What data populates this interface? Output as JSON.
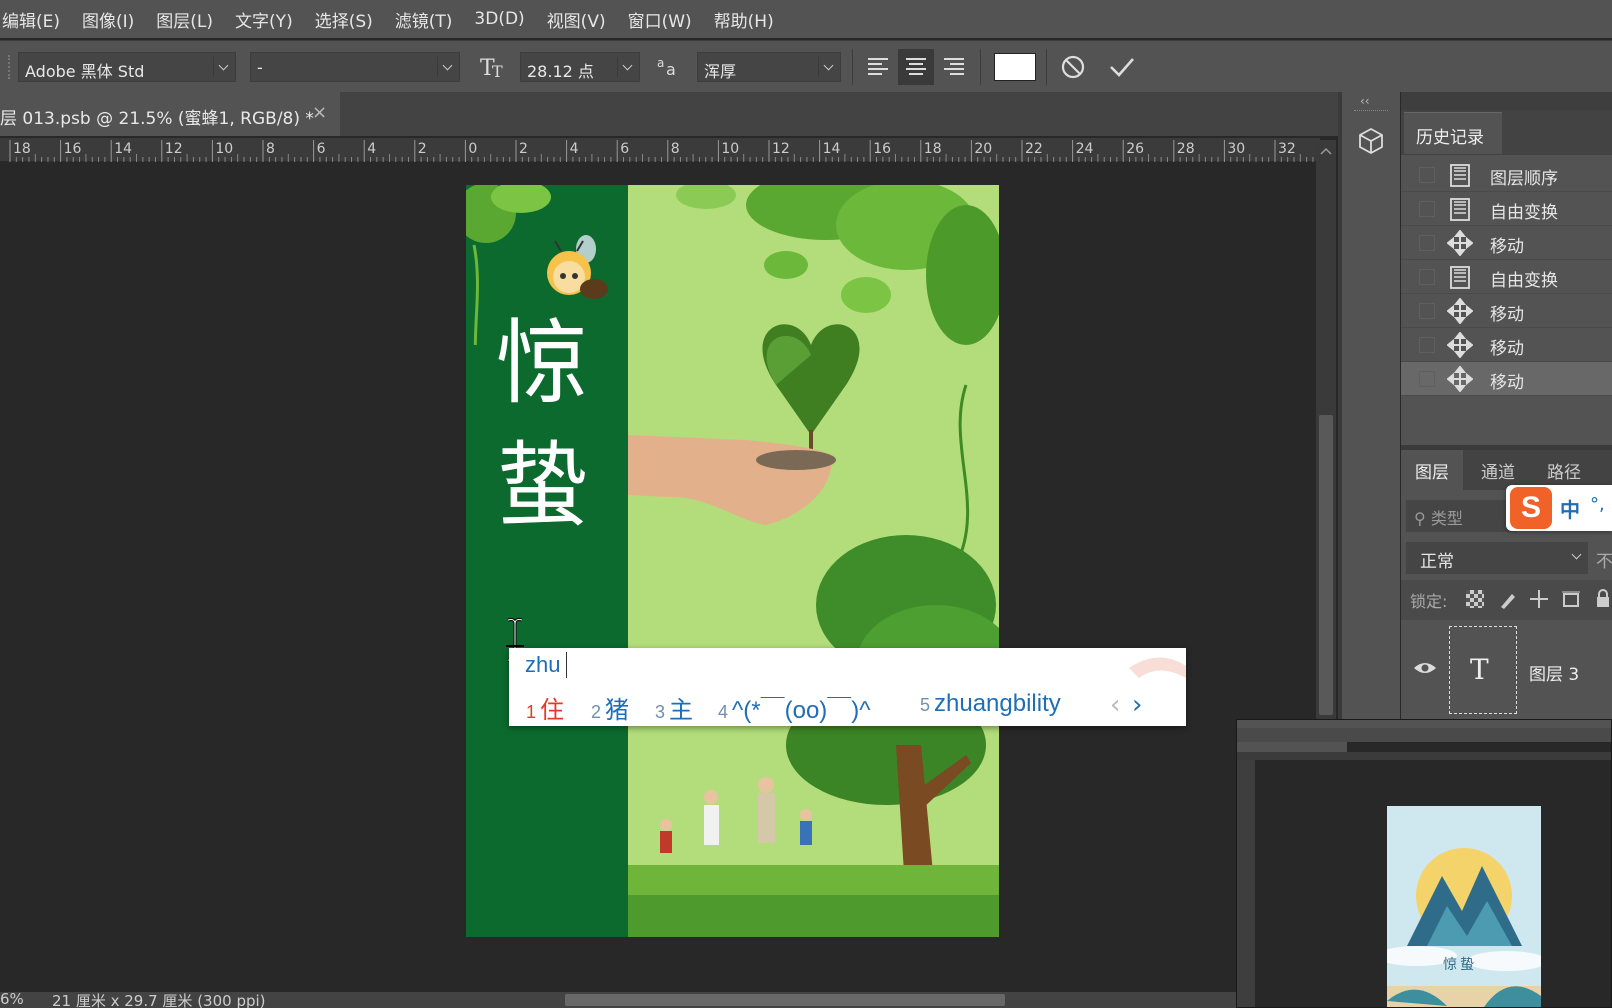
{
  "menu": [
    "编辑(E)",
    "图像(I)",
    "图层(L)",
    "文字(Y)",
    "选择(S)",
    "滤镜(T)",
    "3D(D)",
    "视图(V)",
    "窗口(W)",
    "帮助(H)"
  ],
  "options": {
    "font_family": "Adobe 黑体 Std",
    "font_style": "-",
    "font_size": "28.12 点",
    "antialias": "浑厚",
    "color_swatch": "#ffffff"
  },
  "document": {
    "tab_title": "层 013.psb @ 21.5% (蜜蜂1, RGB/8) *",
    "tab_close": "×"
  },
  "ruler": {
    "ticks": [
      "18",
      "16",
      "14",
      "12",
      "10",
      "8",
      "6",
      "4",
      "2",
      "0",
      "2",
      "4",
      "6",
      "8",
      "10",
      "12",
      "14",
      "16",
      "18",
      "20",
      "22",
      "24",
      "26",
      "28",
      "30",
      "32"
    ]
  },
  "poster": {
    "title_chars": [
      "惊",
      "蛰"
    ],
    "strip_color": "#0c6a2e",
    "bg_color": "#b2dd7a"
  },
  "ime": {
    "input": "zhu",
    "candidates": [
      {
        "num": "1",
        "text": "住"
      },
      {
        "num": "2",
        "text": "猪"
      },
      {
        "num": "3",
        "text": "主"
      },
      {
        "num": "4",
        "text": "^(*￣(oo)￣)^"
      },
      {
        "num": "5",
        "text": "zhuangbility"
      }
    ],
    "prev": "‹",
    "next": "›",
    "selected_color": "#e33b2a"
  },
  "history": {
    "tab": "历史记录",
    "items": [
      {
        "label": "图层顺序",
        "icon": "document-icon"
      },
      {
        "label": "自由变换",
        "icon": "document-icon"
      },
      {
        "label": "移动",
        "icon": "move-icon"
      },
      {
        "label": "自由变换",
        "icon": "document-icon"
      },
      {
        "label": "移动",
        "icon": "move-icon"
      },
      {
        "label": "移动",
        "icon": "move-icon"
      },
      {
        "label": "移动",
        "icon": "move-icon"
      }
    ]
  },
  "layers": {
    "tabs": [
      "图层",
      "通道",
      "路径"
    ],
    "search_placeholder": "类型",
    "blend_mode": "正常",
    "opacity_label": "不",
    "lock_label": "锁定:",
    "layer_name": "图层 3",
    "layer_thumb": "T"
  },
  "sogou": {
    "label": "中",
    "extra": "°,"
  },
  "status": {
    "zoom": "6%",
    "size": "21 厘米 x 29.7 厘米 (300 ppi)"
  },
  "thumb": {
    "title_text": "惊蛰"
  }
}
